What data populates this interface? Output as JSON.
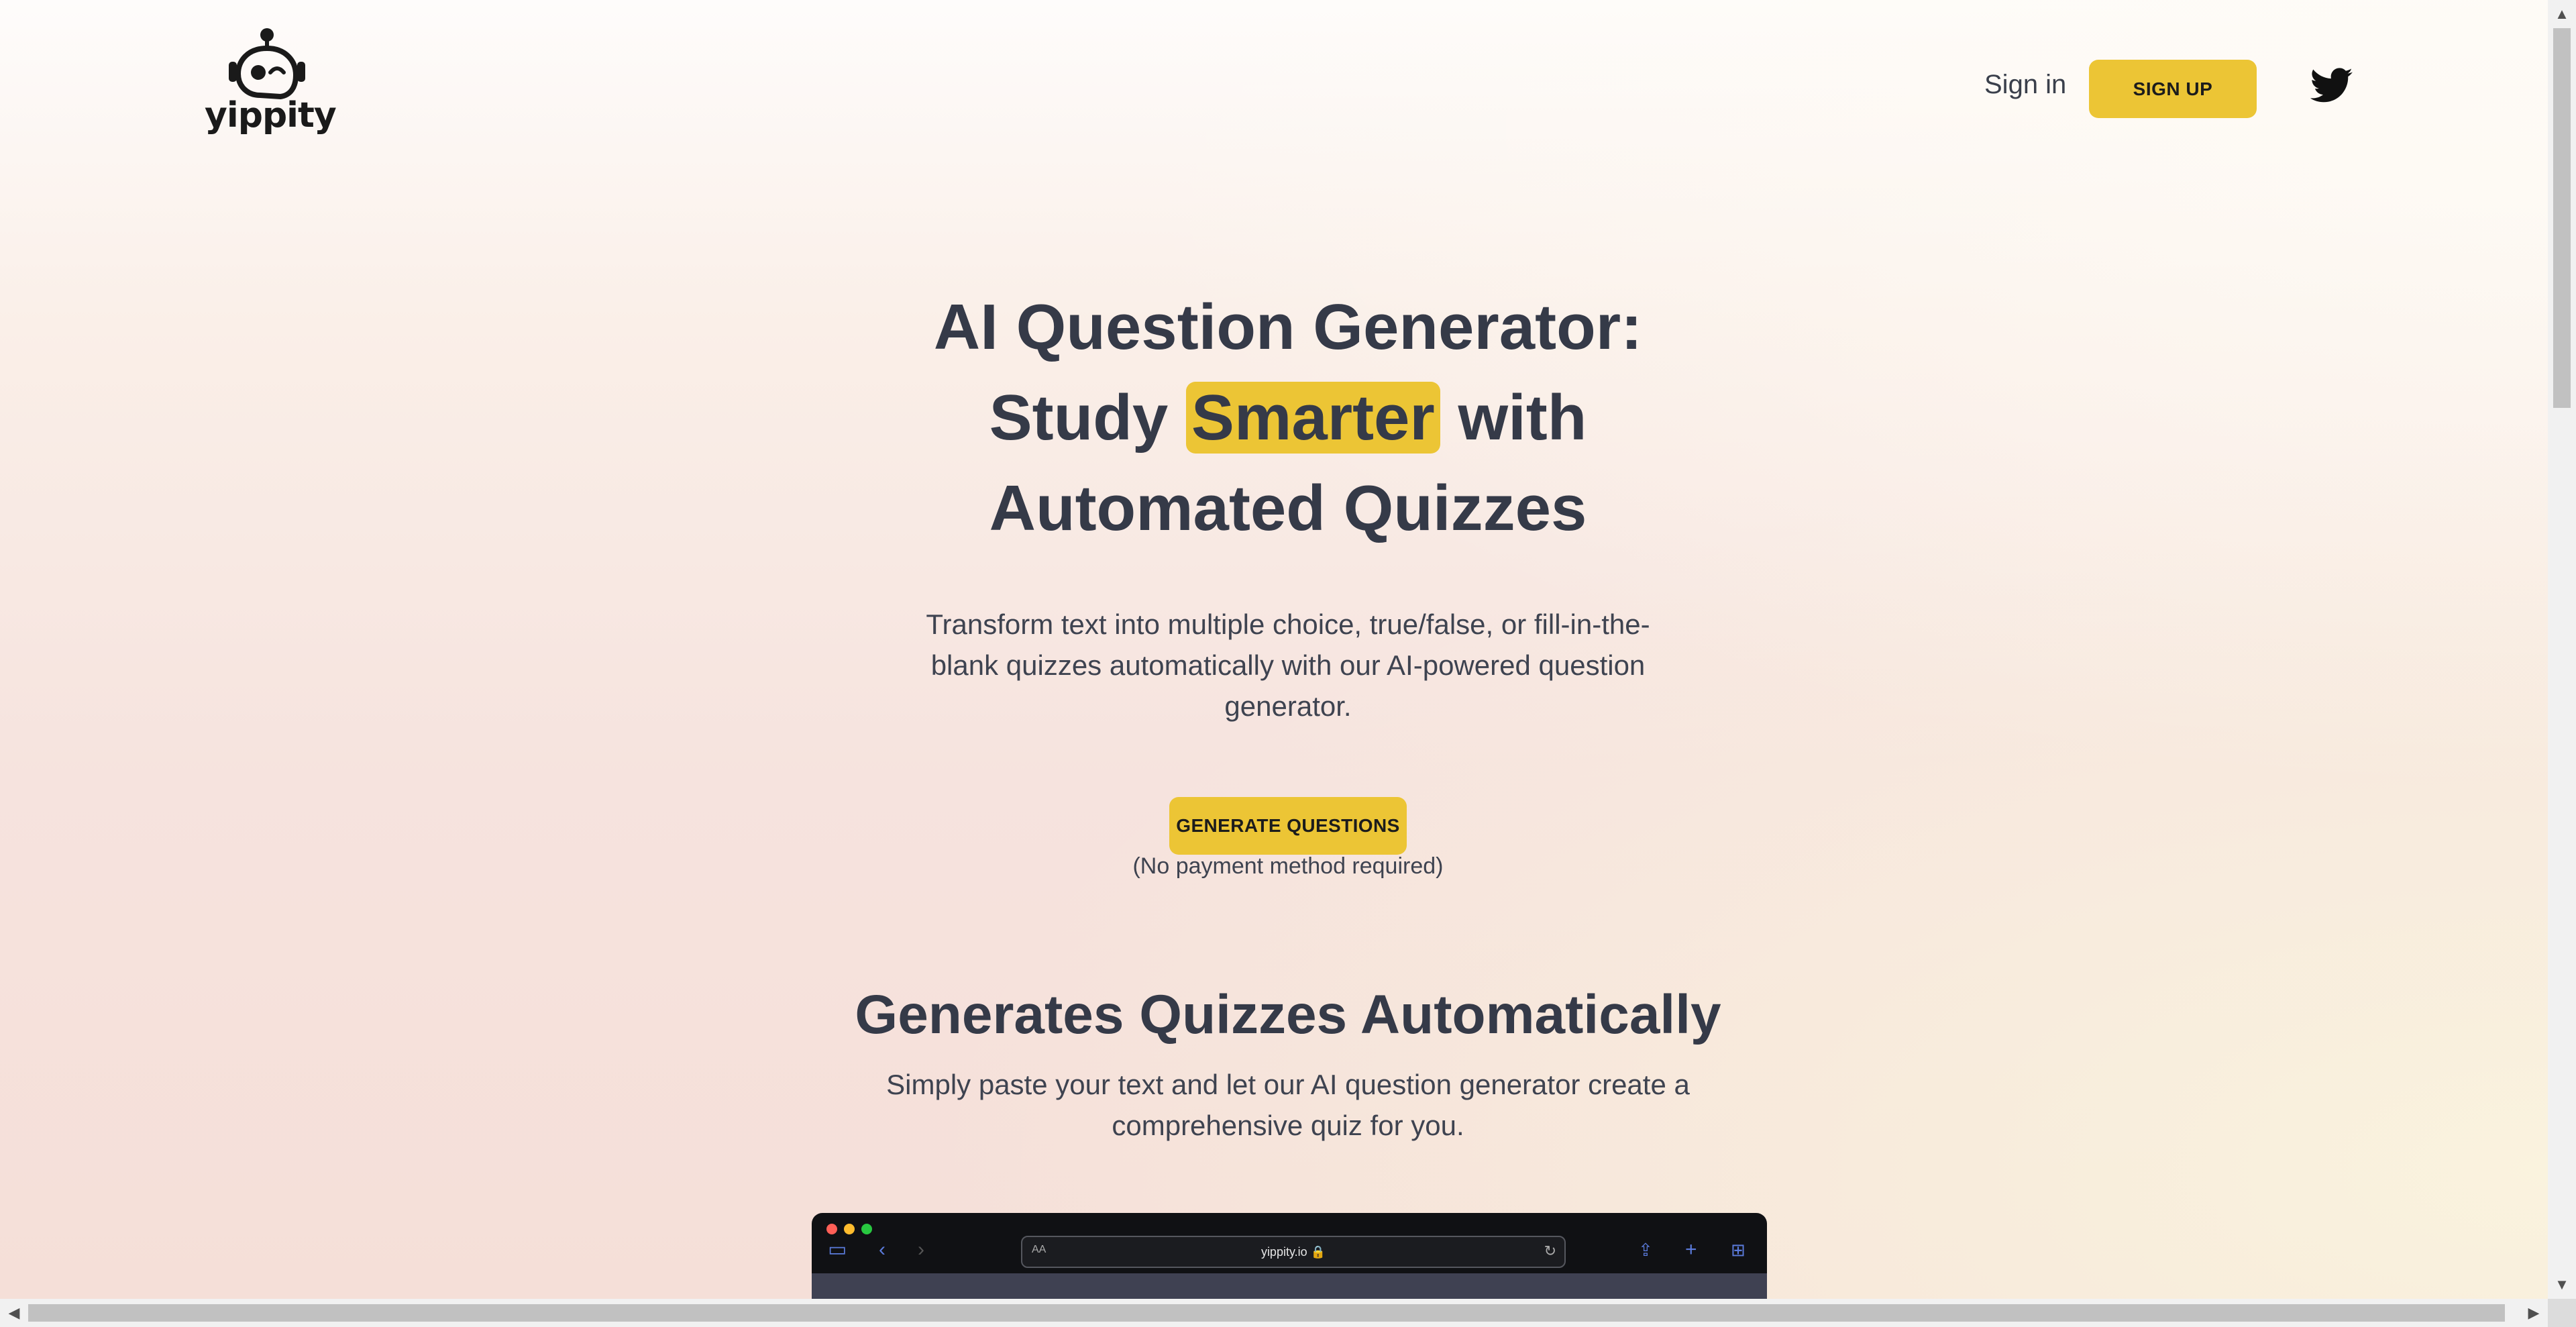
{
  "header": {
    "logo_text": "yippity",
    "signin_label": "Sign in",
    "signup_label": "SIGN UP",
    "social_icon": "twitter-icon"
  },
  "hero": {
    "title_line1": "AI Question Generator:",
    "title_line2_pre": "Study",
    "title_highlight": "Smarter",
    "title_line2_post": "with",
    "title_line3": "Automated Quizzes",
    "description": "Transform text into multiple choice, true/false, or fill-in-the-blank quizzes automatically with our AI-powered question generator.",
    "cta_label": "GENERATE QUESTIONS",
    "cta_note": "(No payment method required)"
  },
  "section": {
    "title": "Generates Quizzes Automatically",
    "description": "Simply paste your text and let our AI question generator create a comprehensive quiz for you."
  },
  "mockup": {
    "address_prefix": "AA",
    "url": "yippity.io 🔒"
  },
  "colors": {
    "accent": "#ecc535",
    "heading": "#353a48",
    "text": "#3e4350"
  }
}
